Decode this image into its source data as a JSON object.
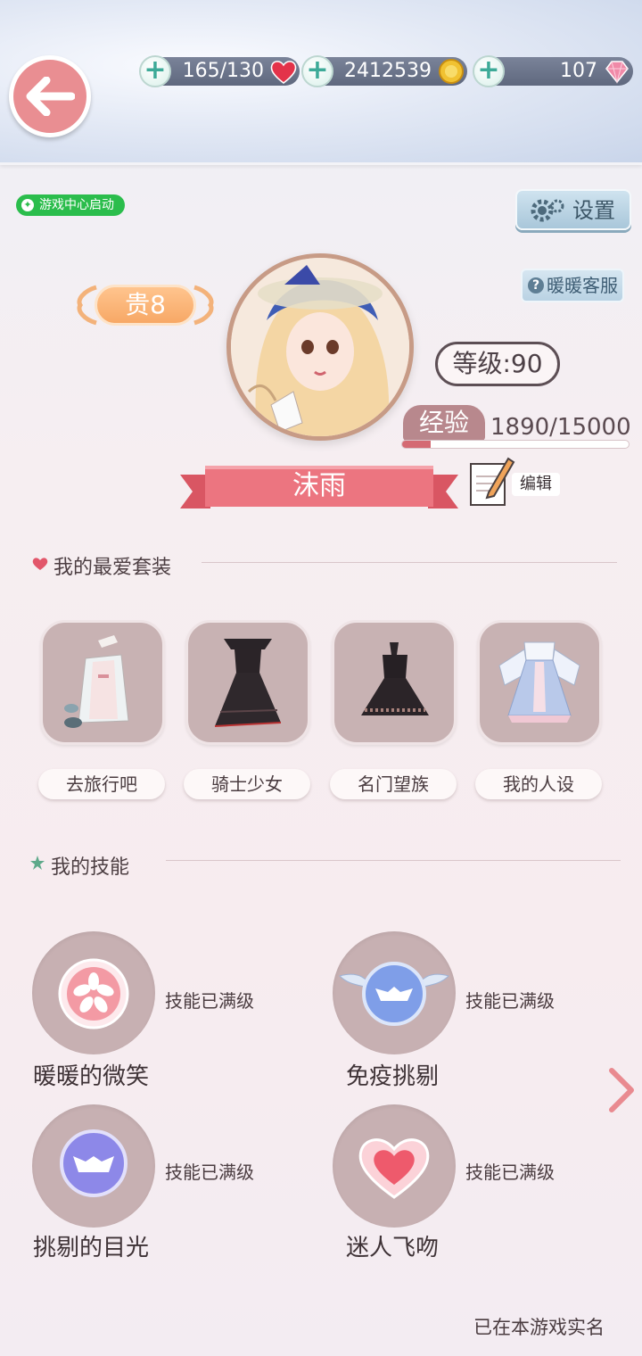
{
  "resources": {
    "stamina": "165/130",
    "coins": "2412539",
    "diamonds": "107"
  },
  "game_center_badge": "游戏中心启动",
  "settings_label": "设置",
  "service_label": "暖暖客服",
  "profile": {
    "vip": "贵8",
    "level": "等级:90",
    "exp_label": "经验",
    "exp_value": "1890/15000",
    "exp_progress": 0.126,
    "name": "沫雨",
    "edit_label": "编辑"
  },
  "favorites": {
    "title": "我的最爱套装",
    "items": [
      {
        "label": "去旅行吧"
      },
      {
        "label": "骑士少女"
      },
      {
        "label": "名门望族"
      },
      {
        "label": "我的人设"
      }
    ]
  },
  "skills": {
    "title": "我的技能",
    "items": [
      {
        "name": "暖暖的微笑",
        "status": "技能已满级",
        "icon": "sakura-icon"
      },
      {
        "name": "免疫挑剔",
        "status": "技能已满级",
        "icon": "winged-mask-icon"
      },
      {
        "name": "挑剔的目光",
        "status": "技能已满级",
        "icon": "mask-icon"
      },
      {
        "name": "迷人飞吻",
        "status": "技能已满级",
        "icon": "heart-icon"
      }
    ]
  },
  "realname_notice": "已在本游戏实名",
  "colors": {
    "accent_pink": "#e98e92",
    "ribbon": "#e8707a",
    "vip_orange": "#f7a866",
    "badge_green": "#2bbd4c"
  }
}
